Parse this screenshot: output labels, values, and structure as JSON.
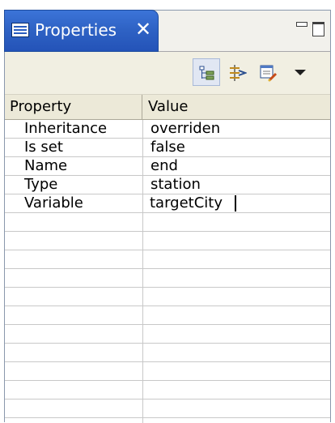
{
  "view": {
    "tab_title": "Properties",
    "close_glyph": "✕"
  },
  "toolbar": {
    "buttons": [
      {
        "icon": "show-categories-icon",
        "active": true
      },
      {
        "icon": "show-advanced-properties-icon",
        "active": false
      },
      {
        "icon": "restore-default-value-icon",
        "active": false
      },
      {
        "icon": "view-menu-dropdown-icon",
        "active": false
      }
    ]
  },
  "table": {
    "headers": {
      "property": "Property",
      "value": "Value"
    },
    "rows": [
      {
        "property": "Inheritance",
        "value": "overriden"
      },
      {
        "property": "Is set",
        "value": "false"
      },
      {
        "property": "Name",
        "value": "end"
      },
      {
        "property": "Type",
        "value": "station"
      },
      {
        "property": "Variable",
        "value": "targetCity",
        "editing": true
      }
    ],
    "empty_row_count": 11
  },
  "colors": {
    "tab_active": "#2f63c5",
    "tab_text": "#ffffff",
    "header_bg": "#ece9d8",
    "toolbar_bg": "#f1efe2",
    "grid_line": "#c8c8c8"
  }
}
